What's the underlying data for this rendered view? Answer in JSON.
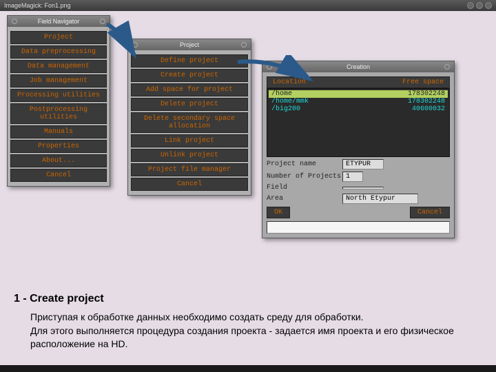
{
  "window_title": "ImageMagick: Fon1.png",
  "navigator": {
    "title": "Field Navigator",
    "items": [
      "Project",
      "Data preprocessing",
      "Data management",
      "Job management",
      "Processing utilities",
      "Postprocessing utilities",
      "Manuals",
      "Properties",
      "About...",
      "Cancel"
    ]
  },
  "project_menu": {
    "title": "Project",
    "items": [
      "Define project",
      "Create project",
      "Add space for project",
      "Delete project",
      "Delete secondary space allocation",
      "Link project",
      "Unlink project",
      "Project file manager",
      "Cancel"
    ]
  },
  "creation": {
    "title": "Creation",
    "loc_header": {
      "left": "Location",
      "right": "Free space"
    },
    "locations": [
      {
        "path": "/home",
        "free": "178302248",
        "selected": true
      },
      {
        "path": "/home/mmk",
        "free": "178302248",
        "selected": false
      },
      {
        "path": "/big200",
        "free": "40600032",
        "selected": false
      }
    ],
    "fields": {
      "project_name_label": "Project name",
      "project_name_value": "ETYPUR",
      "num_projects_label": "Number of Projects",
      "num_projects_value": "1",
      "field_label": "Field",
      "field_value": "",
      "area_label": "Area",
      "area_value": "North Etypur"
    },
    "ok": "OK",
    "cancel": "Cancel"
  },
  "explain": {
    "heading": "1 - Create project",
    "p1": "Приступая к обработке данных необходимо создать среду для  обработки.",
    "p2": "Для этого выполняется процедура создания проекта - задается имя проекта и его физическое расположение на HD."
  }
}
